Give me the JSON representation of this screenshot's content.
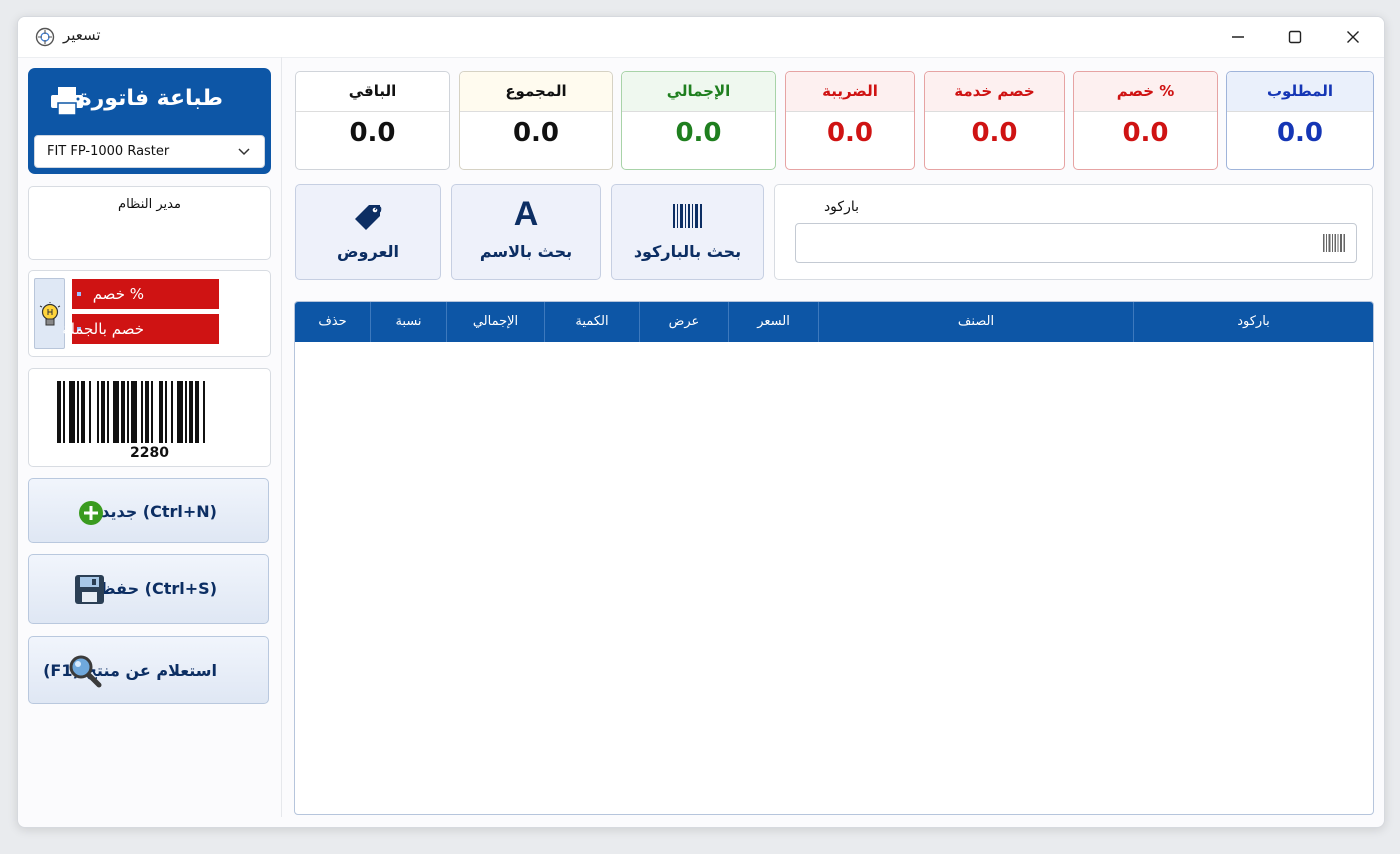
{
  "window": {
    "title": "تسعير"
  },
  "print": {
    "title": "طباعة فاتورة",
    "printer": "FIT FP-1000 Raster"
  },
  "user": {
    "name": "مدير النظام"
  },
  "promos": [
    "خصم %",
    "خصم بالجملة"
  ],
  "barcode": {
    "number": "2280"
  },
  "actions": {
    "new_label": "جديد (Ctrl+N)",
    "save_label": "حفظ (Ctrl+S)",
    "inquiry_label": "(F1) استعلام عن منتج"
  },
  "summary": [
    {
      "label": "المطلوب",
      "value": "0.0",
      "color": "#1536b5"
    },
    {
      "label": "خصم %",
      "value": "0.0",
      "color": "#cf1313"
    },
    {
      "label": "خصم خدمة",
      "value": "0.0",
      "color": "#cf1313"
    },
    {
      "label": "الضريبة",
      "value": "0.0",
      "color": "#cf1313"
    },
    {
      "label": "الإجمالي",
      "value": "0.0",
      "color": "#1f7f1f"
    },
    {
      "label": "المجموع",
      "value": "0.0",
      "color": "#111111"
    },
    {
      "label": "الباقي",
      "value": "0.0",
      "color": "#111111"
    }
  ],
  "tools": {
    "barcode_search": "بحث بالباركود",
    "name_search": "بحث بالاسم",
    "offers": "العروض",
    "name_icon_letter": "A"
  },
  "barcode_input": {
    "label": "باركود",
    "value": ""
  },
  "table": {
    "columns": [
      "باركود",
      "الصنف",
      "السعر",
      "عرض",
      "الكمية",
      "الإجمالي",
      "نسبة",
      "حذف"
    ]
  },
  "colors": {
    "primary": "#0d56a6",
    "danger": "#cf1313"
  }
}
